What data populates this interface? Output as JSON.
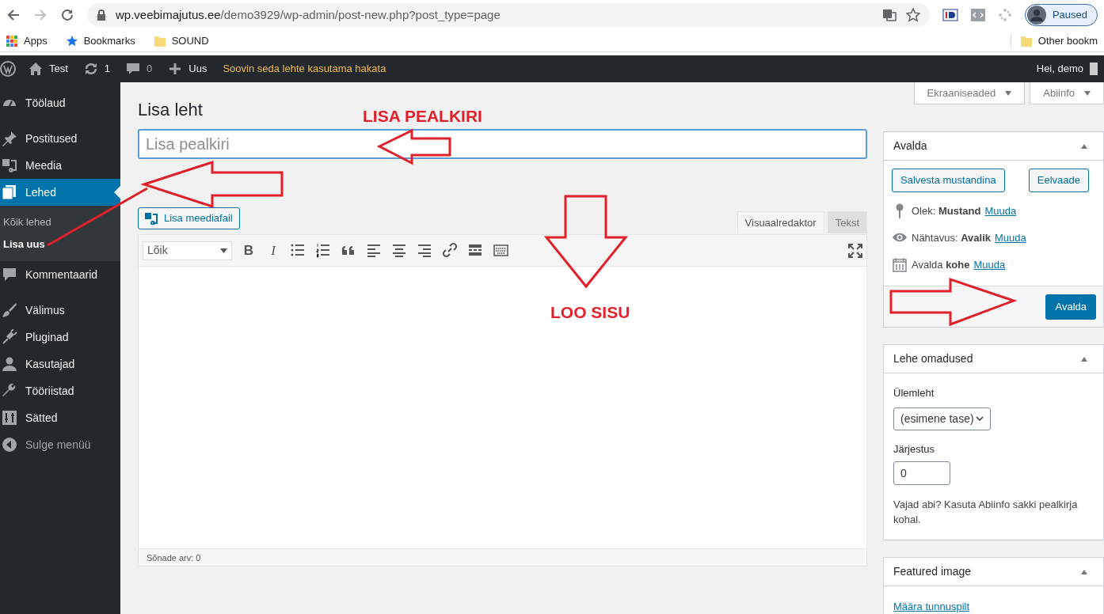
{
  "browser": {
    "url_host": "wp.veebimajutus.ee",
    "url_path": "/demo3929/wp-admin/post-new.php?post_type=page",
    "profile": "Paused",
    "bookmarks": [
      "Apps",
      "Bookmarks",
      "SOUND"
    ],
    "other_bookmarks": "Other bookm"
  },
  "admin_bar": {
    "site": "Test",
    "updates": "1",
    "comments": "0",
    "new": "Uus",
    "notice": "Soovin seda lehte kasutama hakata",
    "greeting": "Hei, demo"
  },
  "sidebar": {
    "items": [
      {
        "label": "Töölaud",
        "selected": false
      },
      {
        "label": "Postitused",
        "selected": false
      },
      {
        "label": "Meedia",
        "selected": false
      },
      {
        "label": "Lehed",
        "selected": true,
        "children": [
          {
            "label": "Kõik lehed",
            "selected": false
          },
          {
            "label": "Lisa uus",
            "selected": true
          }
        ]
      },
      {
        "label": "Kommentaarid",
        "selected": false
      },
      {
        "label": "Välimus",
        "selected": false
      },
      {
        "label": "Pluginad",
        "selected": false
      },
      {
        "label": "Kasutajad",
        "selected": false
      },
      {
        "label": "Tööriistad",
        "selected": false
      },
      {
        "label": "Sätted",
        "selected": false
      },
      {
        "label": "Sulge menüü",
        "selected": false
      }
    ]
  },
  "screen_tabs": [
    "Ekraaniseaded",
    "Abiinfo"
  ],
  "page_title": "Lisa leht",
  "title_field": {
    "placeholder": "Lisa pealkiri"
  },
  "add_media": "Lisa meediafail",
  "editor_tabs": [
    {
      "label": "Visuaalredaktor",
      "selected": true
    },
    {
      "label": "Tekst",
      "selected": false
    }
  ],
  "format_select": "Lõik",
  "toolbar": [
    {
      "kind": "bold",
      "label": "B"
    },
    {
      "kind": "italic",
      "label": "I"
    },
    {
      "kind": "bullets"
    },
    {
      "kind": "numbers"
    },
    {
      "kind": "quote"
    },
    {
      "kind": "alignleft"
    },
    {
      "kind": "aligncenter"
    },
    {
      "kind": "alignright"
    },
    {
      "kind": "link"
    },
    {
      "kind": "more"
    },
    {
      "kind": "keyboard"
    }
  ],
  "word_count": "Sõnade arv: 0",
  "publish_box": {
    "title": "Avalda",
    "save_draft": "Salvesta mustandina",
    "preview": "Eelvaade",
    "rows": [
      {
        "kind": "status",
        "text": "Olek: **Mustand**",
        "link": "Muuda"
      },
      {
        "kind": "visibility",
        "text": "Nähtavus: **Avalik**",
        "link": "Muuda"
      },
      {
        "kind": "schedule",
        "text": "Avalda **kohe**",
        "link": "Muuda"
      }
    ],
    "publish": "Avalda"
  },
  "page_attributes": {
    "title": "Lehe omadused",
    "parent_label": "Ülemleht",
    "parent_value": "(esimene tase)",
    "order_label": "Järjestus",
    "order_value": "0",
    "help": "Vajad abi? Kasuta Abiinfo sakki pealkirja kohal."
  },
  "featured_image": {
    "title": "Featured image",
    "link": "Määra tunnuspilt"
  },
  "annotations": [
    {
      "text": "LISA PEALKIRI"
    },
    {
      "text": "LOO SISU"
    }
  ]
}
